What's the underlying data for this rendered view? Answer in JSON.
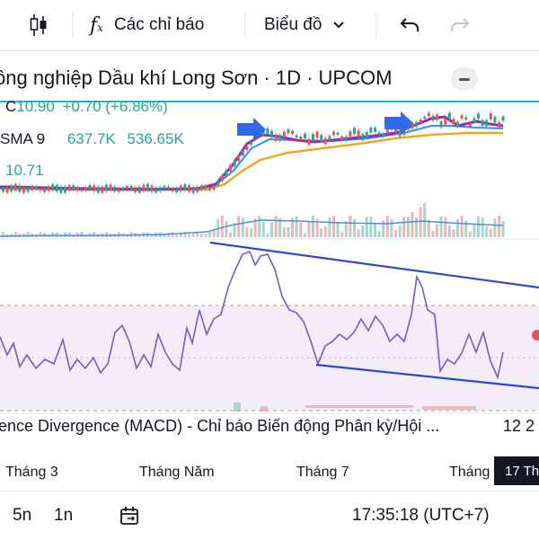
{
  "toolbar": {
    "indicators_label": "Các chỉ báo",
    "chart_type_label": "Biểu đồ",
    "icons": [
      "candles-icon",
      "indicators-fx-icon",
      "chevron-down-icon",
      "undo-icon",
      "redo-icon"
    ]
  },
  "legend": {
    "title": "ông nghiệp Dầu khí Long Sơn · 1D · UPCOM",
    "close_prefix": "C",
    "close_value": "10.90",
    "change": "+0.70 (+6.86%)",
    "sma_label": "SMA 9",
    "vol_value_1": "637.7K",
    "vol_value_2": "536.65K",
    "ma_value": "10.71"
  },
  "macd": {
    "label": "ence Divergence (MACD) - Chỉ báo Biến động Phân kỳ/Hội ...",
    "value": "12 2"
  },
  "time_axis": {
    "labels": [
      "Tháng 3",
      "Tháng Năm",
      "Tháng 7",
      "Tháng"
    ],
    "current_date": "17 Th"
  },
  "bottom": {
    "interval_5": "5n",
    "interval_1": "1n",
    "clock": "17:35:18 (UTC+7)"
  },
  "colors": {
    "up": "#26a69a",
    "down": "#ef5350",
    "sma_fast": "#9c27b0",
    "sma_mid": "#2196f3",
    "sma_slow": "#f4a51c",
    "rsi_line": "#7e57c2",
    "trendline": "#2e46d8",
    "arrow": "#2f6ae8",
    "price_line": "#22b8c0"
  }
}
